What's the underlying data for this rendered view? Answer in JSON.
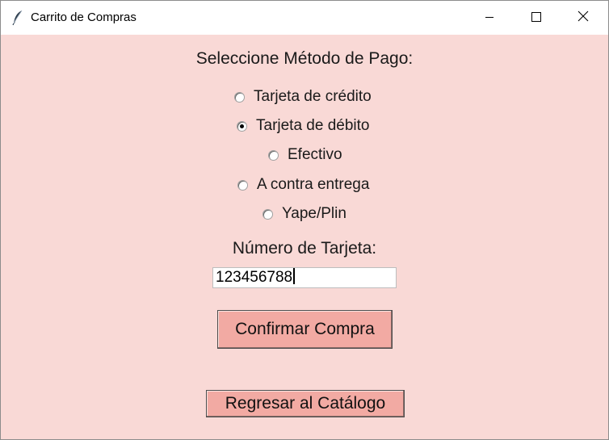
{
  "window": {
    "title": "Carrito de Compras",
    "icon": "feather-icon",
    "controls": [
      "minimize-icon",
      "maximize-icon",
      "close-icon"
    ]
  },
  "payment": {
    "heading": "Seleccione Método de Pago:",
    "options": [
      {
        "label": "Tarjeta de crédito",
        "selected": false
      },
      {
        "label": "Tarjeta de débito",
        "selected": true
      },
      {
        "label": "Efectivo",
        "selected": false
      },
      {
        "label": "A contra entrega",
        "selected": false
      },
      {
        "label": "Yape/Plin",
        "selected": false
      }
    ]
  },
  "card": {
    "label": "Número de Tarjeta:",
    "value": "123456788"
  },
  "buttons": {
    "confirm": "Confirmar Compra",
    "back": "Regresar al Catálogo"
  },
  "colors": {
    "background": "#f9d9d6",
    "button": "#f2aaa3"
  }
}
